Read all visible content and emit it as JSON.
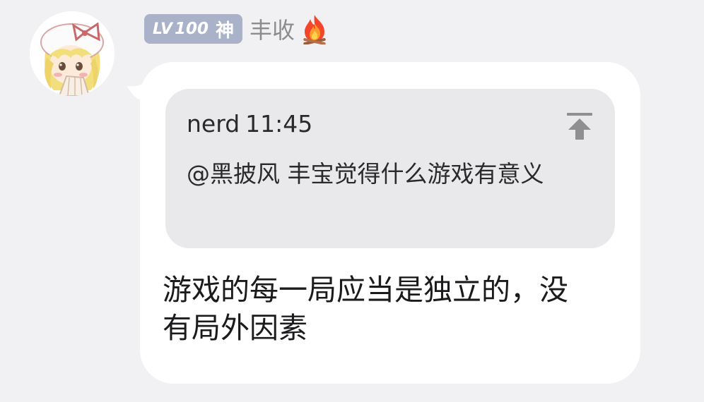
{
  "sender": {
    "level_prefix": "LV",
    "level_number": "100",
    "rank_title": "神",
    "nickname": "丰收",
    "status_icon": "fire-icon"
  },
  "quote": {
    "author": "nerd",
    "time": "11:45",
    "text": "@黑披风 丰宝觉得什么游戏有意义",
    "jump_icon": "jump-to-original-icon"
  },
  "message": {
    "text": "游戏的每一局应当是独立的，没有局外因素"
  },
  "colors": {
    "background": "#f1f1f3",
    "bubble": "#ffffff",
    "quote_background": "#e9e9eb",
    "level_badge": "#a9b2c9",
    "nickname": "#8c8c8f"
  }
}
